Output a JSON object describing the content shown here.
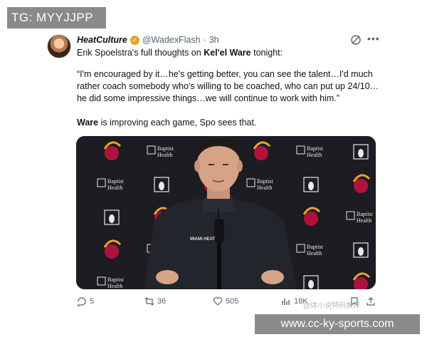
{
  "watermark_top": "TG: MYYJJPP",
  "watermark_bottom": "www.cc-ky-sports.com",
  "watermark_faint": "@体小说特码推荐",
  "tweet": {
    "author_name": "HeatCulture",
    "handle": "@WadexFlash",
    "separator": "·",
    "time": "3h",
    "more_label": "•••",
    "line1_prefix": "Erik Spoelstra's full thoughts on ",
    "line1_bold": "Kel'el Ware",
    "line1_suffix": " tonight:",
    "quote": "“I'm encouraged by it…he's getting better, you can see the talent…I'd much rather coach somebody who's willing to be coached, who can put up 24/10…he did some impressive things…we will continue to work with him.”",
    "summary_bold": "Ware",
    "summary_rest": " is improving each game, Spo sees that.",
    "backdrop_sponsor_line1": "Baptist",
    "backdrop_sponsor_line2": "Health",
    "jersey_text": "MIAMI HEAT"
  },
  "actions": {
    "replies": "5",
    "reposts": "36",
    "likes": "505",
    "views": "18K"
  },
  "colors": {
    "backdrop": "#1c1c22",
    "heat_red": "#b0123c",
    "flame": "#f2a02a",
    "text_muted": "#536471",
    "watermark_bg": "#8a8a8a"
  },
  "icons": [
    "verified-icon",
    "grok-icon",
    "more-icon",
    "reply-icon",
    "repost-icon",
    "like-icon",
    "views-icon",
    "bookmark-icon",
    "share-icon"
  ]
}
